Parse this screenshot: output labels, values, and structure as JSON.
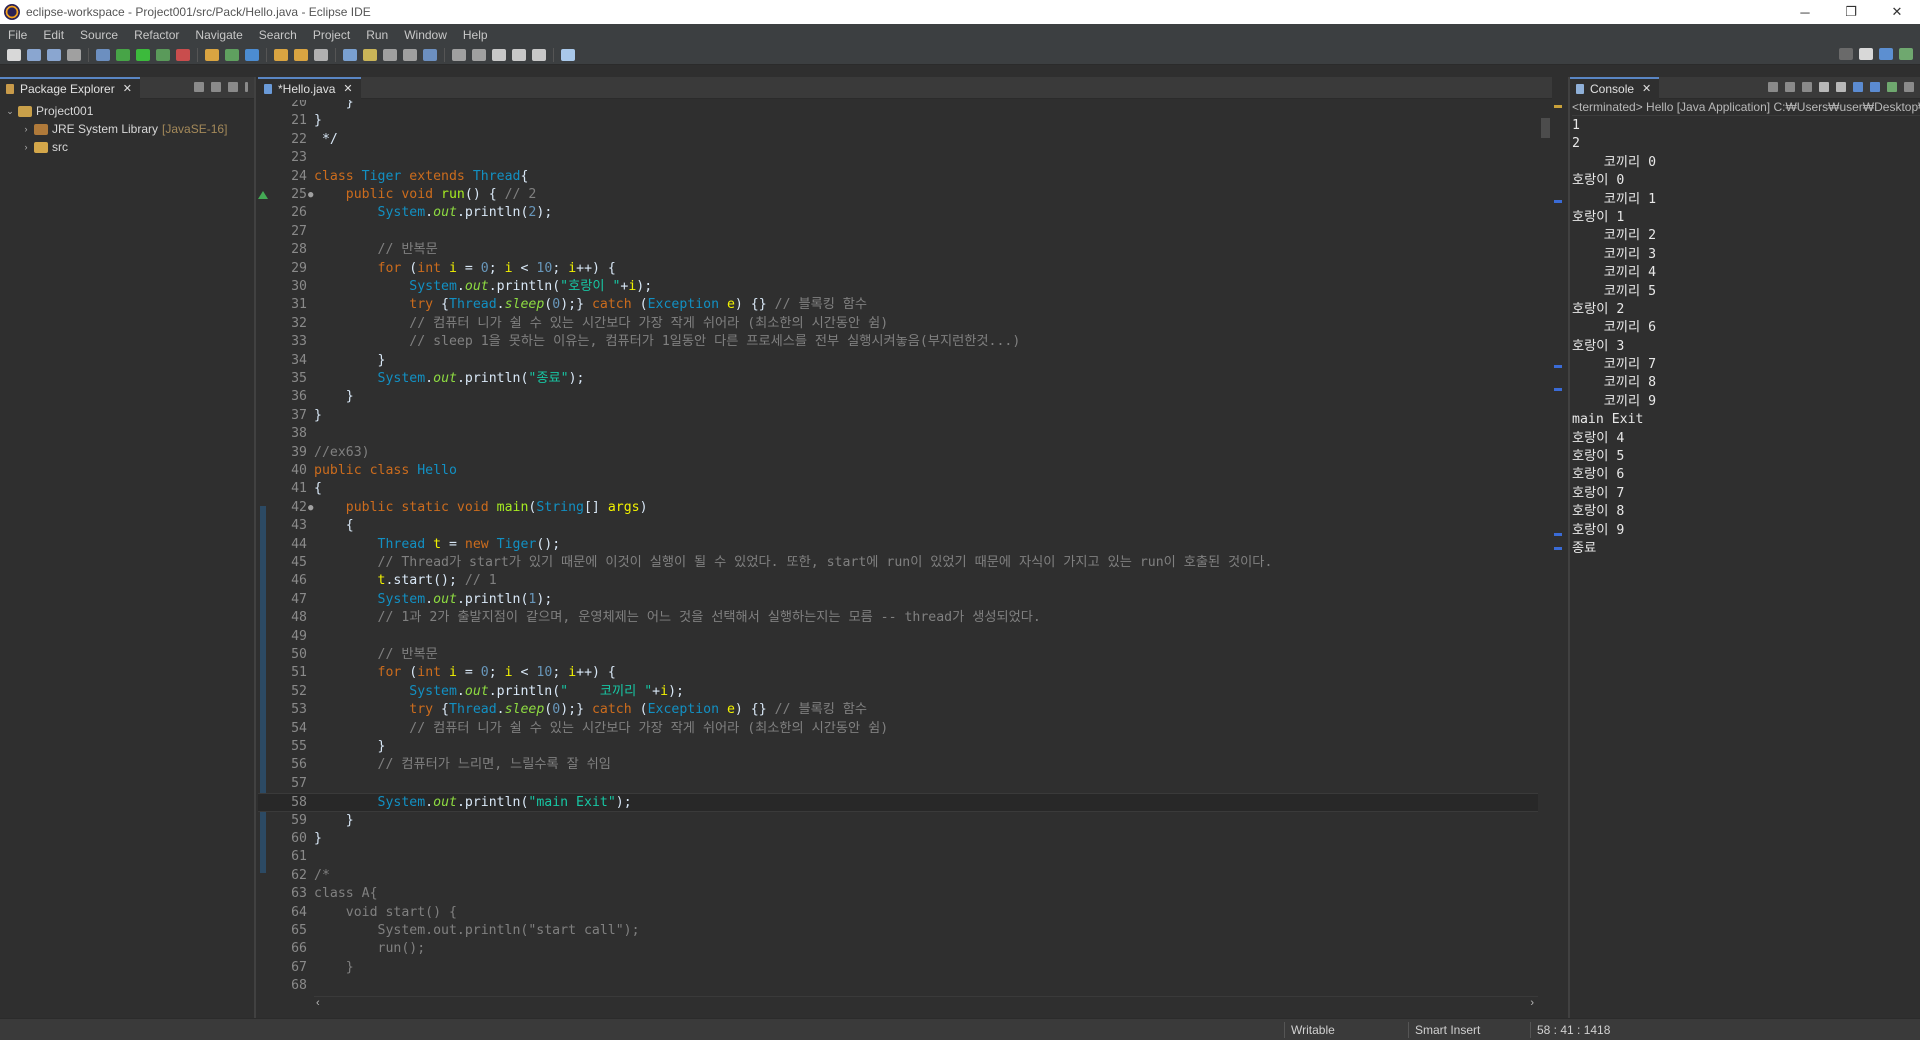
{
  "window": {
    "title": "eclipse-workspace - Project001/src/Pack/Hello.java - Eclipse IDE",
    "minimize": "─",
    "restore": "❐",
    "close": "✕"
  },
  "menu": [
    "File",
    "Edit",
    "Source",
    "Refactor",
    "Navigate",
    "Search",
    "Project",
    "Run",
    "Window",
    "Help"
  ],
  "package_explorer": {
    "tab_label": "Package Explorer",
    "close": "✕",
    "tree": [
      {
        "label": "Project001",
        "arrow": "⌄",
        "extra": ""
      },
      {
        "label": "JRE System Library",
        "arrow": "›",
        "extra": "[JavaSE-16]"
      },
      {
        "label": "src",
        "arrow": "›",
        "extra": ""
      }
    ]
  },
  "editor": {
    "tab_label": "*Hello.java",
    "close": "✕",
    "scroll_left": "‹",
    "scroll_right": "›"
  },
  "code_lines": [
    {
      "n": "20",
      "mark": "",
      "tokens": [
        [
          "plain",
          "    }"
        ]
      ]
    },
    {
      "n": "21",
      "mark": "",
      "tokens": [
        [
          "plain",
          "}"
        ]
      ]
    },
    {
      "n": "22",
      "mark": "",
      "tokens": [
        [
          "plain",
          " */"
        ]
      ]
    },
    {
      "n": "23",
      "mark": "",
      "tokens": []
    },
    {
      "n": "24",
      "mark": "",
      "tokens": [
        [
          "kw",
          "class "
        ],
        [
          "type",
          "Tiger "
        ],
        [
          "kw",
          "extends "
        ],
        [
          "type",
          "Thread"
        ],
        [
          "plain",
          "{"
        ]
      ]
    },
    {
      "n": "25",
      "mark": "●",
      "tokens": [
        [
          "plain",
          "    "
        ],
        [
          "kw",
          "public void "
        ],
        [
          "meth",
          "run"
        ],
        [
          "plain",
          "() { "
        ],
        [
          "com",
          "// 2"
        ]
      ]
    },
    {
      "n": "26",
      "mark": "",
      "tokens": [
        [
          "plain",
          "        "
        ],
        [
          "type",
          "System"
        ],
        [
          "plain",
          "."
        ],
        [
          "field",
          "out"
        ],
        [
          "plain",
          ".println("
        ],
        [
          "num",
          "2"
        ],
        [
          "plain",
          ");"
        ]
      ]
    },
    {
      "n": "27",
      "mark": "",
      "tokens": []
    },
    {
      "n": "28",
      "mark": "",
      "tokens": [
        [
          "plain",
          "        "
        ],
        [
          "com",
          "// 반복문"
        ]
      ]
    },
    {
      "n": "29",
      "mark": "",
      "tokens": [
        [
          "plain",
          "        "
        ],
        [
          "kw",
          "for "
        ],
        [
          "plain",
          "("
        ],
        [
          "kw",
          "int "
        ],
        [
          "var",
          "i "
        ],
        [
          "plain",
          "= "
        ],
        [
          "num",
          "0"
        ],
        [
          "plain",
          "; "
        ],
        [
          "var",
          "i "
        ],
        [
          "plain",
          "< "
        ],
        [
          "num",
          "10"
        ],
        [
          "plain",
          "; "
        ],
        [
          "var",
          "i"
        ],
        [
          "plain",
          "++) {"
        ]
      ]
    },
    {
      "n": "30",
      "mark": "",
      "tokens": [
        [
          "plain",
          "            "
        ],
        [
          "type",
          "System"
        ],
        [
          "plain",
          "."
        ],
        [
          "field",
          "out"
        ],
        [
          "plain",
          ".println("
        ],
        [
          "str",
          "\"호랑이 \""
        ],
        [
          "plain",
          "+"
        ],
        [
          "var",
          "i"
        ],
        [
          "plain",
          ");"
        ]
      ]
    },
    {
      "n": "31",
      "mark": "",
      "tokens": [
        [
          "plain",
          "            "
        ],
        [
          "kw",
          "try "
        ],
        [
          "plain",
          "{"
        ],
        [
          "type",
          "Thread"
        ],
        [
          "plain",
          "."
        ],
        [
          "field",
          "sleep"
        ],
        [
          "plain",
          "("
        ],
        [
          "num",
          "0"
        ],
        [
          "plain",
          ");} "
        ],
        [
          "kw",
          "catch "
        ],
        [
          "plain",
          "("
        ],
        [
          "type",
          "Exception "
        ],
        [
          "var",
          "e"
        ],
        [
          "plain",
          ") {} "
        ],
        [
          "com",
          "// 블록킹 함수"
        ]
      ]
    },
    {
      "n": "32",
      "mark": "",
      "tokens": [
        [
          "plain",
          "            "
        ],
        [
          "com",
          "// 컴퓨터 니가 쉴 수 있는 시간보다 가장 작게 쉬어라 (최소한의 시간동안 쉼)"
        ]
      ]
    },
    {
      "n": "33",
      "mark": "",
      "tokens": [
        [
          "plain",
          "            "
        ],
        [
          "com",
          "// sleep 1을 못하는 이유는, 컴퓨터가 1일동안 다른 프로세스를 전부 실행시켜놓음(부지런한것...)"
        ]
      ]
    },
    {
      "n": "34",
      "mark": "",
      "tokens": [
        [
          "plain",
          "        }"
        ]
      ]
    },
    {
      "n": "35",
      "mark": "",
      "tokens": [
        [
          "plain",
          "        "
        ],
        [
          "type",
          "System"
        ],
        [
          "plain",
          "."
        ],
        [
          "field",
          "out"
        ],
        [
          "plain",
          ".println("
        ],
        [
          "str",
          "\"종료\""
        ],
        [
          "plain",
          ");"
        ]
      ]
    },
    {
      "n": "36",
      "mark": "",
      "tokens": [
        [
          "plain",
          "    }"
        ]
      ]
    },
    {
      "n": "37",
      "mark": "",
      "tokens": [
        [
          "plain",
          "}"
        ]
      ]
    },
    {
      "n": "38",
      "mark": "",
      "tokens": []
    },
    {
      "n": "39",
      "mark": "",
      "tokens": [
        [
          "com",
          "//ex63)"
        ]
      ]
    },
    {
      "n": "40",
      "mark": "",
      "tokens": [
        [
          "kw",
          "public class "
        ],
        [
          "type",
          "Hello"
        ]
      ]
    },
    {
      "n": "41",
      "mark": "",
      "tokens": [
        [
          "plain",
          "{"
        ]
      ]
    },
    {
      "n": "42",
      "mark": "●",
      "tokens": [
        [
          "plain",
          "    "
        ],
        [
          "kw",
          "public static void "
        ],
        [
          "meth",
          "main"
        ],
        [
          "plain",
          "("
        ],
        [
          "type",
          "String"
        ],
        [
          "plain",
          "[] "
        ],
        [
          "var",
          "args"
        ],
        [
          "plain",
          ")"
        ]
      ]
    },
    {
      "n": "43",
      "mark": "",
      "tokens": [
        [
          "plain",
          "    {"
        ]
      ]
    },
    {
      "n": "44",
      "mark": "",
      "tokens": [
        [
          "plain",
          "        "
        ],
        [
          "type",
          "Thread "
        ],
        [
          "var",
          "t "
        ],
        [
          "plain",
          "= "
        ],
        [
          "kw",
          "new "
        ],
        [
          "type",
          "Tiger"
        ],
        [
          "plain",
          "();"
        ]
      ]
    },
    {
      "n": "45",
      "mark": "",
      "tokens": [
        [
          "plain",
          "        "
        ],
        [
          "com",
          "// Thread가 start가 있기 때문에 이것이 실행이 될 수 있었다. 또한, start에 run이 있었기 때문에 자식이 가지고 있는 run이 호출된 것이다."
        ]
      ]
    },
    {
      "n": "46",
      "mark": "",
      "tokens": [
        [
          "plain",
          "        "
        ],
        [
          "var",
          "t"
        ],
        [
          "plain",
          ".start(); "
        ],
        [
          "com",
          "// 1"
        ]
      ]
    },
    {
      "n": "47",
      "mark": "",
      "tokens": [
        [
          "plain",
          "        "
        ],
        [
          "type",
          "System"
        ],
        [
          "plain",
          "."
        ],
        [
          "field",
          "out"
        ],
        [
          "plain",
          ".println("
        ],
        [
          "num",
          "1"
        ],
        [
          "plain",
          ");"
        ]
      ]
    },
    {
      "n": "48",
      "mark": "",
      "tokens": [
        [
          "plain",
          "        "
        ],
        [
          "com",
          "// 1과 2가 출발지점이 같으며, 운영체제는 어느 것을 선택해서 실행하는지는 모름 -- thread가 생성되었다."
        ]
      ]
    },
    {
      "n": "49",
      "mark": "",
      "tokens": []
    },
    {
      "n": "50",
      "mark": "",
      "tokens": [
        [
          "plain",
          "        "
        ],
        [
          "com",
          "// 반복문"
        ]
      ]
    },
    {
      "n": "51",
      "mark": "",
      "tokens": [
        [
          "plain",
          "        "
        ],
        [
          "kw",
          "for "
        ],
        [
          "plain",
          "("
        ],
        [
          "kw",
          "int "
        ],
        [
          "var",
          "i "
        ],
        [
          "plain",
          "= "
        ],
        [
          "num",
          "0"
        ],
        [
          "plain",
          "; "
        ],
        [
          "var",
          "i "
        ],
        [
          "plain",
          "< "
        ],
        [
          "num",
          "10"
        ],
        [
          "plain",
          "; "
        ],
        [
          "var",
          "i"
        ],
        [
          "plain",
          "++) {"
        ]
      ]
    },
    {
      "n": "52",
      "mark": "",
      "tokens": [
        [
          "plain",
          "            "
        ],
        [
          "type",
          "System"
        ],
        [
          "plain",
          "."
        ],
        [
          "field",
          "out"
        ],
        [
          "plain",
          ".println("
        ],
        [
          "str",
          "\"    코끼리 \""
        ],
        [
          "plain",
          "+"
        ],
        [
          "var",
          "i"
        ],
        [
          "plain",
          ");"
        ]
      ]
    },
    {
      "n": "53",
      "mark": "",
      "tokens": [
        [
          "plain",
          "            "
        ],
        [
          "kw",
          "try "
        ],
        [
          "plain",
          "{"
        ],
        [
          "type",
          "Thread"
        ],
        [
          "plain",
          "."
        ],
        [
          "field",
          "sleep"
        ],
        [
          "plain",
          "("
        ],
        [
          "num",
          "0"
        ],
        [
          "plain",
          ");} "
        ],
        [
          "kw",
          "catch "
        ],
        [
          "plain",
          "("
        ],
        [
          "type",
          "Exception "
        ],
        [
          "var",
          "e"
        ],
        [
          "plain",
          ") {} "
        ],
        [
          "com",
          "// 블록킹 함수"
        ]
      ]
    },
    {
      "n": "54",
      "mark": "",
      "tokens": [
        [
          "plain",
          "            "
        ],
        [
          "com",
          "// 컴퓨터 니가 쉴 수 있는 시간보다 가장 작게 쉬어라 (최소한의 시간동안 쉼)"
        ]
      ]
    },
    {
      "n": "55",
      "mark": "",
      "tokens": [
        [
          "plain",
          "        }"
        ]
      ]
    },
    {
      "n": "56",
      "mark": "",
      "tokens": [
        [
          "plain",
          "        "
        ],
        [
          "com",
          "// 컴퓨터가 느리면, 느릴수록 잘 쉬임"
        ]
      ]
    },
    {
      "n": "57",
      "mark": "",
      "tokens": []
    },
    {
      "n": "58",
      "mark": "",
      "tokens": [
        [
          "plain",
          "        "
        ],
        [
          "type",
          "System"
        ],
        [
          "plain",
          "."
        ],
        [
          "field",
          "out"
        ],
        [
          "plain",
          ".println("
        ],
        [
          "str",
          "\"main Exit\""
        ],
        [
          "plain",
          ");"
        ]
      ]
    },
    {
      "n": "59",
      "mark": "",
      "tokens": [
        [
          "plain",
          "    }"
        ]
      ]
    },
    {
      "n": "60",
      "mark": "",
      "tokens": [
        [
          "plain",
          "}"
        ]
      ]
    },
    {
      "n": "61",
      "mark": "",
      "tokens": []
    },
    {
      "n": "62",
      "mark": "",
      "tokens": [
        [
          "com",
          "/*"
        ]
      ]
    },
    {
      "n": "63",
      "mark": "",
      "tokens": [
        [
          "com",
          "class A{"
        ]
      ]
    },
    {
      "n": "64",
      "mark": "",
      "tokens": [
        [
          "com",
          "    void start() {"
        ]
      ]
    },
    {
      "n": "65",
      "mark": "",
      "tokens": [
        [
          "com",
          "        System.out.println(\"start call\");"
        ]
      ]
    },
    {
      "n": "66",
      "mark": "",
      "tokens": [
        [
          "com",
          "        run();"
        ]
      ]
    },
    {
      "n": "67",
      "mark": "",
      "tokens": [
        [
          "com",
          "    }"
        ]
      ]
    },
    {
      "n": "68",
      "mark": "",
      "tokens": []
    }
  ],
  "console": {
    "tab_label": "Console",
    "close": "✕",
    "status": "<terminated> Hello [Java Application] C:₩Users₩user₩Desktop₩",
    "scroll_left": "‹",
    "scroll_right": "›",
    "output": [
      "1",
      "2",
      "    코끼리 0",
      "호랑이 0",
      "    코끼리 1",
      "호랑이 1",
      "    코끼리 2",
      "    코끼리 3",
      "    코끼리 4",
      "    코끼리 5",
      "호랑이 2",
      "    코끼리 6",
      "호랑이 3",
      "    코끼리 7",
      "    코끼리 8",
      "    코끼리 9",
      "main Exit",
      "호랑이 4",
      "호랑이 5",
      "호랑이 6",
      "호랑이 7",
      "호랑이 8",
      "호랑이 9",
      "종료"
    ]
  },
  "statusbar": {
    "writable": "Writable",
    "insert_mode": "Smart Insert",
    "position": "58 : 41 : 1418"
  },
  "colors": {
    "keyword": "#cc6c1d",
    "type": "#1290c3",
    "string": "#17c6a3",
    "comment": "#808080",
    "variable": "#f2f200"
  }
}
